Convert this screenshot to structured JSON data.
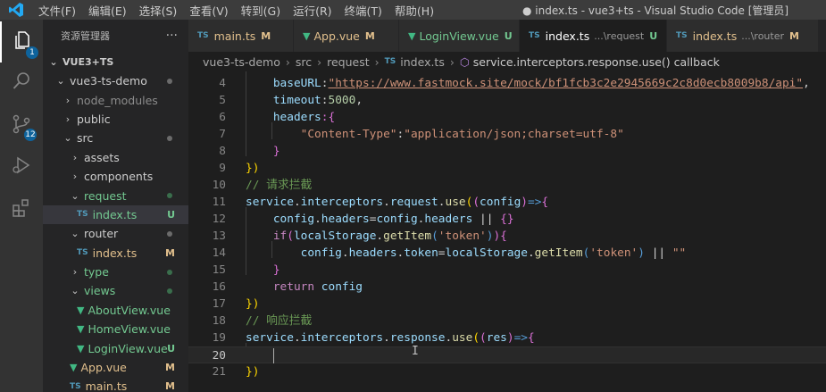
{
  "menu": [
    "文件(F)",
    "编辑(E)",
    "选择(S)",
    "查看(V)",
    "转到(G)",
    "运行(R)",
    "终端(T)",
    "帮助(H)"
  ],
  "window_title": "● index.ts - vue3+ts - Visual Studio Code [管理员]",
  "activity": {
    "explorer_badge": "1",
    "scm_badge": "12"
  },
  "sidebar": {
    "title": "资源管理器",
    "more": "···",
    "section": "VUE3+TS",
    "rows": [
      {
        "label": "vue3-ts-demo",
        "chev": "⌄",
        "depth": 1,
        "type": "folder",
        "dot": true
      },
      {
        "label": "node_modules",
        "chev": "›",
        "depth": 2,
        "type": "folder",
        "dim": true
      },
      {
        "label": "public",
        "chev": "›",
        "depth": 2,
        "type": "folder"
      },
      {
        "label": "src",
        "chev": "⌄",
        "depth": 2,
        "type": "folder",
        "dot": true
      },
      {
        "label": "assets",
        "chev": "›",
        "depth": 3,
        "type": "folder"
      },
      {
        "label": "components",
        "chev": "›",
        "depth": 3,
        "type": "folder"
      },
      {
        "label": "request",
        "chev": "⌄",
        "depth": 3,
        "type": "folder",
        "dot": true,
        "green": true
      },
      {
        "label": "index.ts",
        "depth": 4,
        "type": "ts",
        "status": "U",
        "green": true,
        "selected": true
      },
      {
        "label": "router",
        "chev": "⌄",
        "depth": 3,
        "type": "folder",
        "dot": true
      },
      {
        "label": "index.ts",
        "depth": 4,
        "type": "ts",
        "status": "M"
      },
      {
        "label": "type",
        "chev": "›",
        "depth": 3,
        "type": "folder",
        "dot": true,
        "green": true
      },
      {
        "label": "views",
        "chev": "⌄",
        "depth": 3,
        "type": "folder",
        "dot": true,
        "green": true
      },
      {
        "label": "AboutView.vue",
        "depth": 4,
        "type": "vue",
        "green": true
      },
      {
        "label": "HomeView.vue",
        "depth": 4,
        "type": "vue",
        "green": true
      },
      {
        "label": "LoginView.vue",
        "depth": 4,
        "type": "vue",
        "status": "U",
        "green": true
      },
      {
        "label": "App.vue",
        "depth": 3,
        "type": "vue",
        "status": "M"
      },
      {
        "label": "main.ts",
        "depth": 3,
        "type": "ts",
        "status": "M"
      }
    ]
  },
  "tabs": [
    {
      "icon": "TS",
      "label": "main.ts",
      "status": "M"
    },
    {
      "icon": "V",
      "label": "App.vue",
      "status": "M"
    },
    {
      "icon": "V",
      "label": "LoginView.vue",
      "status": "U"
    },
    {
      "icon": "TS",
      "label": "index.ts",
      "desc": "...\\request",
      "status": "U",
      "active": true,
      "dirty": true
    },
    {
      "icon": "TS",
      "label": "index.ts",
      "desc": "...\\router",
      "status": "M"
    }
  ],
  "breadcrumb": {
    "parts": [
      "vue3-ts-demo",
      "src",
      "request"
    ],
    "file": "index.ts",
    "symbol": "service.interceptors.response.use() callback"
  },
  "editor": {
    "line_numbers": [
      "4",
      "5",
      "6",
      "7",
      "8",
      "9",
      "10",
      "11",
      "12",
      "13",
      "14",
      "15",
      "16",
      "17",
      "18",
      "19",
      "20",
      "21"
    ],
    "current_line": "20",
    "lines": [
      [
        [
          "    ",
          ""
        ],
        [
          "baseURL",
          "k-var"
        ],
        [
          ":",
          ""
        ],
        [
          "\"https://www.fastmock.site/mock/bf1fcb3c2e2945669c2c8d0ecb8009b8/api\"",
          "k-url"
        ],
        [
          ",",
          ""
        ]
      ],
      [
        [
          "    ",
          ""
        ],
        [
          "timeout",
          "k-var"
        ],
        [
          ":",
          ""
        ],
        [
          "5000",
          "k-num"
        ],
        [
          ",",
          ""
        ]
      ],
      [
        [
          "    ",
          ""
        ],
        [
          "headers",
          "k-var"
        ],
        [
          ":{",
          "k-pur"
        ]
      ],
      [
        [
          "        ",
          ""
        ],
        [
          "\"Content-Type\"",
          "k-str"
        ],
        [
          ":",
          ""
        ],
        [
          "\"application/json;charset=utf-8\"",
          "k-str"
        ]
      ],
      [
        [
          "    ",
          ""
        ],
        [
          "}",
          "k-pur"
        ]
      ],
      [
        [
          "})",
          "k-yel"
        ]
      ],
      [
        [
          "// 请求拦截",
          "k-com"
        ]
      ],
      [
        [
          "service",
          "k-var"
        ],
        [
          ".",
          ""
        ],
        [
          "interceptors",
          "k-var"
        ],
        [
          ".",
          ""
        ],
        [
          "request",
          "k-var"
        ],
        [
          ".",
          ""
        ],
        [
          "use",
          "k-fn"
        ],
        [
          "(",
          "k-yel"
        ],
        [
          "(",
          "k-pur"
        ],
        [
          "config",
          "k-var"
        ],
        [
          ")",
          "k-pur"
        ],
        [
          "=>",
          "k-blue"
        ],
        [
          "{",
          "k-pur"
        ]
      ],
      [
        [
          "    ",
          ""
        ],
        [
          "config",
          "k-var"
        ],
        [
          ".",
          ""
        ],
        [
          "headers",
          "k-var"
        ],
        [
          "=",
          ""
        ],
        [
          "config",
          "k-var"
        ],
        [
          ".",
          ""
        ],
        [
          "headers",
          "k-var"
        ],
        [
          " || ",
          ""
        ],
        [
          "{}",
          "k-pur"
        ]
      ],
      [
        [
          "    ",
          ""
        ],
        [
          "if",
          "k-ctl"
        ],
        [
          "(",
          "k-pur"
        ],
        [
          "localStorage",
          "k-var"
        ],
        [
          ".",
          ""
        ],
        [
          "getItem",
          "k-fn"
        ],
        [
          "(",
          "k-blue"
        ],
        [
          "'token'",
          "k-str"
        ],
        [
          ")",
          "k-blue"
        ],
        [
          ")",
          "k-pur"
        ],
        [
          "{",
          "k-pur"
        ]
      ],
      [
        [
          "        ",
          ""
        ],
        [
          "config",
          "k-var"
        ],
        [
          ".",
          ""
        ],
        [
          "headers",
          "k-var"
        ],
        [
          ".",
          ""
        ],
        [
          "token",
          "k-var"
        ],
        [
          "=",
          ""
        ],
        [
          "localStorage",
          "k-var"
        ],
        [
          ".",
          ""
        ],
        [
          "getItem",
          "k-fn"
        ],
        [
          "(",
          "k-blue"
        ],
        [
          "'token'",
          "k-str"
        ],
        [
          ")",
          "k-blue"
        ],
        [
          " || ",
          ""
        ],
        [
          "\"\"",
          "k-str"
        ]
      ],
      [
        [
          "    ",
          ""
        ],
        [
          "}",
          "k-pur"
        ]
      ],
      [
        [
          "    ",
          ""
        ],
        [
          "return",
          "k-ctl"
        ],
        [
          " ",
          ""
        ],
        [
          "config",
          "k-var"
        ]
      ],
      [
        [
          "})",
          "k-yel"
        ]
      ],
      [
        [
          "// 响应拦截",
          "k-com"
        ]
      ],
      [
        [
          "service",
          "k-var"
        ],
        [
          ".",
          ""
        ],
        [
          "interceptors",
          "k-var"
        ],
        [
          ".",
          ""
        ],
        [
          "response",
          "k-var"
        ],
        [
          ".",
          ""
        ],
        [
          "use",
          "k-fn"
        ],
        [
          "(",
          "k-yel"
        ],
        [
          "(",
          "k-pur"
        ],
        [
          "res",
          "k-var"
        ],
        [
          ")",
          "k-pur"
        ],
        [
          "=>",
          "k-blue"
        ],
        [
          "{",
          "k-pur"
        ]
      ],
      [
        [
          "    ",
          ""
        ]
      ],
      [
        [
          "})",
          "k-yel"
        ]
      ]
    ]
  },
  "colors": {
    "accent": "#0e639c",
    "git_untracked": "#73c991",
    "git_modified": "#e2c08d"
  },
  "icons": [
    "vscode-logo-icon",
    "explorer-icon",
    "search-icon",
    "source-control-icon",
    "run-debug-icon",
    "extensions-icon",
    "typescript-file-icon",
    "vue-file-icon",
    "symbol-method-icon"
  ]
}
